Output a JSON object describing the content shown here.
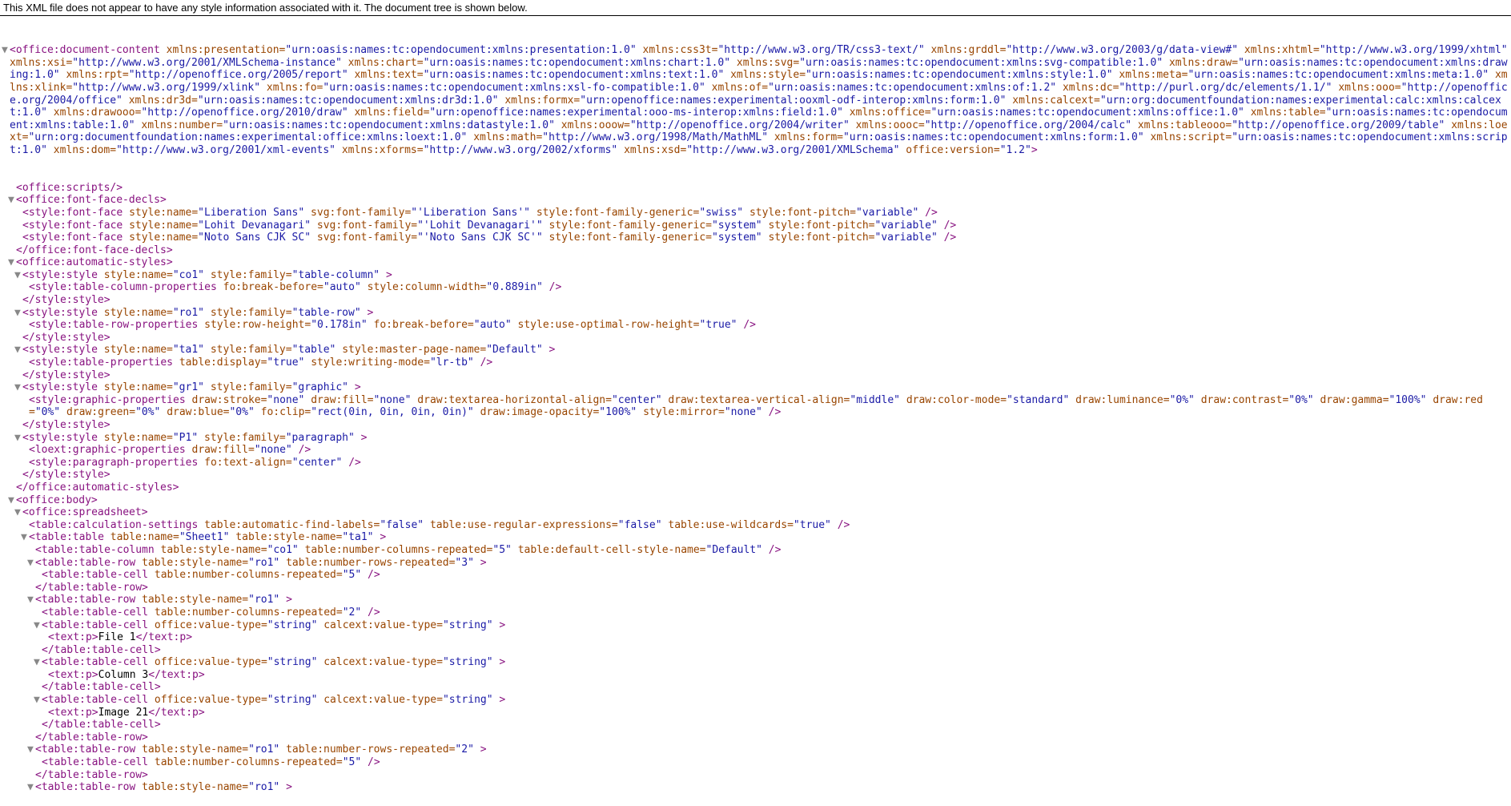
{
  "header_message": "This XML file does not appear to have any style information associated with it. The document tree is shown below.",
  "root": {
    "open": "<office:document-content",
    "attrs": [
      {
        "n": "xmlns:presentation",
        "v": "urn:oasis:names:tc:opendocument:xmlns:presentation:1.0"
      },
      {
        "n": "xmlns:css3t",
        "v": "http://www.w3.org/TR/css3-text/"
      },
      {
        "n": "xmlns:grddl",
        "v": "http://www.w3.org/2003/g/data-view#"
      },
      {
        "n": "xmlns:xhtml",
        "v": "http://www.w3.org/1999/xhtml"
      },
      {
        "n": "xmlns:xsi",
        "v": "http://www.w3.org/2001/XMLSchema-instance"
      },
      {
        "n": "xmlns:chart",
        "v": "urn:oasis:names:tc:opendocument:xmlns:chart:1.0"
      },
      {
        "n": "xmlns:svg",
        "v": "urn:oasis:names:tc:opendocument:xmlns:svg-compatible:1.0"
      },
      {
        "n": "xmlns:draw",
        "v": "urn:oasis:names:tc:opendocument:xmlns:drawing:1.0"
      },
      {
        "n": "xmlns:rpt",
        "v": "http://openoffice.org/2005/report"
      },
      {
        "n": "xmlns:text",
        "v": "urn:oasis:names:tc:opendocument:xmlns:text:1.0"
      },
      {
        "n": "xmlns:style",
        "v": "urn:oasis:names:tc:opendocument:xmlns:style:1.0"
      },
      {
        "n": "xmlns:meta",
        "v": "urn:oasis:names:tc:opendocument:xmlns:meta:1.0"
      },
      {
        "n": "xmlns:xlink",
        "v": "http://www.w3.org/1999/xlink"
      },
      {
        "n": "xmlns:fo",
        "v": "urn:oasis:names:tc:opendocument:xmlns:xsl-fo-compatible:1.0"
      },
      {
        "n": "xmlns:of",
        "v": "urn:oasis:names:tc:opendocument:xmlns:of:1.2"
      },
      {
        "n": "xmlns:dc",
        "v": "http://purl.org/dc/elements/1.1/"
      },
      {
        "n": "xmlns:ooo",
        "v": "http://openoffice.org/2004/office"
      },
      {
        "n": "xmlns:dr3d",
        "v": "urn:oasis:names:tc:opendocument:xmlns:dr3d:1.0"
      },
      {
        "n": "xmlns:formx",
        "v": "urn:openoffice:names:experimental:ooxml-odf-interop:xmlns:form:1.0"
      },
      {
        "n": "xmlns:calcext",
        "v": "urn:org:documentfoundation:names:experimental:calc:xmlns:calcext:1.0"
      },
      {
        "n": "xmlns:drawooo",
        "v": "http://openoffice.org/2010/draw"
      },
      {
        "n": "xmlns:field",
        "v": "urn:openoffice:names:experimental:ooo-ms-interop:xmlns:field:1.0"
      },
      {
        "n": "xmlns:office",
        "v": "urn:oasis:names:tc:opendocument:xmlns:office:1.0"
      },
      {
        "n": "xmlns:table",
        "v": "urn:oasis:names:tc:opendocument:xmlns:table:1.0"
      },
      {
        "n": "xmlns:number",
        "v": "urn:oasis:names:tc:opendocument:xmlns:datastyle:1.0"
      },
      {
        "n": "xmlns:ooow",
        "v": "http://openoffice.org/2004/writer"
      },
      {
        "n": "xmlns:oooc",
        "v": "http://openoffice.org/2004/calc"
      },
      {
        "n": "xmlns:tableooo",
        "v": "http://openoffice.org/2009/table"
      },
      {
        "n": "xmlns:loext",
        "v": "urn:org:documentfoundation:names:experimental:office:xmlns:loext:1.0"
      },
      {
        "n": "xmlns:math",
        "v": "http://www.w3.org/1998/Math/MathML"
      },
      {
        "n": "xmlns:form",
        "v": "urn:oasis:names:tc:opendocument:xmlns:form:1.0"
      },
      {
        "n": "xmlns:script",
        "v": "urn:oasis:names:tc:opendocument:xmlns:script:1.0"
      },
      {
        "n": "xmlns:dom",
        "v": "http://www.w3.org/2001/xml-events"
      },
      {
        "n": "xmlns:xforms",
        "v": "http://www.w3.org/2002/xforms"
      },
      {
        "n": "xmlns:xsd",
        "v": "http://www.w3.org/2001/XMLSchema"
      },
      {
        "n": "office:version",
        "v": "1.2"
      }
    ],
    "close": ">"
  },
  "lines": [
    {
      "i": 1,
      "t": null,
      "parts": [
        {
          "tag": "<office:scripts/>"
        }
      ]
    },
    {
      "i": 1,
      "t": "▼",
      "parts": [
        {
          "tag": "<office:font-face-decls>"
        }
      ]
    },
    {
      "i": 2,
      "t": null,
      "parts": [
        {
          "tag": "<style:font-face "
        },
        {
          "an": "style:name",
          "av": "Liberation Sans"
        },
        {
          "an": "svg:font-family",
          "av": "'Liberation Sans'"
        },
        {
          "an": "style:font-family-generic",
          "av": "swiss"
        },
        {
          "an": "style:font-pitch",
          "av": "variable"
        },
        {
          "tag": "/>"
        }
      ]
    },
    {
      "i": 2,
      "t": null,
      "parts": [
        {
          "tag": "<style:font-face "
        },
        {
          "an": "style:name",
          "av": "Lohit Devanagari"
        },
        {
          "an": "svg:font-family",
          "av": "'Lohit Devanagari'"
        },
        {
          "an": "style:font-family-generic",
          "av": "system"
        },
        {
          "an": "style:font-pitch",
          "av": "variable"
        },
        {
          "tag": "/>"
        }
      ]
    },
    {
      "i": 2,
      "t": null,
      "parts": [
        {
          "tag": "<style:font-face "
        },
        {
          "an": "style:name",
          "av": "Noto Sans CJK SC"
        },
        {
          "an": "svg:font-family",
          "av": "'Noto Sans CJK SC'"
        },
        {
          "an": "style:font-family-generic",
          "av": "system"
        },
        {
          "an": "style:font-pitch",
          "av": "variable"
        },
        {
          "tag": "/>"
        }
      ]
    },
    {
      "i": 1,
      "t": null,
      "parts": [
        {
          "tag": "</office:font-face-decls>"
        }
      ]
    },
    {
      "i": 1,
      "t": "▼",
      "parts": [
        {
          "tag": "<office:automatic-styles>"
        }
      ]
    },
    {
      "i": 2,
      "t": "▼",
      "parts": [
        {
          "tag": "<style:style "
        },
        {
          "an": "style:name",
          "av": "co1"
        },
        {
          "an": "style:family",
          "av": "table-column"
        },
        {
          "tag": ">"
        }
      ]
    },
    {
      "i": 3,
      "t": null,
      "parts": [
        {
          "tag": "<style:table-column-properties "
        },
        {
          "an": "fo:break-before",
          "av": "auto"
        },
        {
          "an": "style:column-width",
          "av": "0.889in"
        },
        {
          "tag": "/>"
        }
      ]
    },
    {
      "i": 2,
      "t": null,
      "parts": [
        {
          "tag": "</style:style>"
        }
      ]
    },
    {
      "i": 2,
      "t": "▼",
      "parts": [
        {
          "tag": "<style:style "
        },
        {
          "an": "style:name",
          "av": "ro1"
        },
        {
          "an": "style:family",
          "av": "table-row"
        },
        {
          "tag": ">"
        }
      ]
    },
    {
      "i": 3,
      "t": null,
      "parts": [
        {
          "tag": "<style:table-row-properties "
        },
        {
          "an": "style:row-height",
          "av": "0.178in"
        },
        {
          "an": "fo:break-before",
          "av": "auto"
        },
        {
          "an": "style:use-optimal-row-height",
          "av": "true"
        },
        {
          "tag": "/>"
        }
      ]
    },
    {
      "i": 2,
      "t": null,
      "parts": [
        {
          "tag": "</style:style>"
        }
      ]
    },
    {
      "i": 2,
      "t": "▼",
      "parts": [
        {
          "tag": "<style:style "
        },
        {
          "an": "style:name",
          "av": "ta1"
        },
        {
          "an": "style:family",
          "av": "table"
        },
        {
          "an": "style:master-page-name",
          "av": "Default"
        },
        {
          "tag": ">"
        }
      ]
    },
    {
      "i": 3,
      "t": null,
      "parts": [
        {
          "tag": "<style:table-properties "
        },
        {
          "an": "table:display",
          "av": "true"
        },
        {
          "an": "style:writing-mode",
          "av": "lr-tb"
        },
        {
          "tag": "/>"
        }
      ]
    },
    {
      "i": 2,
      "t": null,
      "parts": [
        {
          "tag": "</style:style>"
        }
      ]
    },
    {
      "i": 2,
      "t": "▼",
      "parts": [
        {
          "tag": "<style:style "
        },
        {
          "an": "style:name",
          "av": "gr1"
        },
        {
          "an": "style:family",
          "av": "graphic"
        },
        {
          "tag": ">"
        }
      ]
    },
    {
      "i": 3,
      "t": null,
      "parts": [
        {
          "tag": "<style:graphic-properties "
        },
        {
          "an": "draw:stroke",
          "av": "none"
        },
        {
          "an": "draw:fill",
          "av": "none"
        },
        {
          "an": "draw:textarea-horizontal-align",
          "av": "center"
        },
        {
          "an": "draw:textarea-vertical-align",
          "av": "middle"
        },
        {
          "an": "draw:color-mode",
          "av": "standard"
        },
        {
          "an": "draw:luminance",
          "av": "0%"
        },
        {
          "an": "draw:contrast",
          "av": "0%"
        },
        {
          "an": "draw:gamma",
          "av": "100%"
        },
        {
          "an": "draw:red",
          "av": "0%"
        },
        {
          "an": "draw:green",
          "av": "0%"
        },
        {
          "an": "draw:blue",
          "av": "0%"
        },
        {
          "an": "fo:clip",
          "av": "rect(0in, 0in, 0in, 0in)"
        },
        {
          "an": "draw:image-opacity",
          "av": "100%"
        },
        {
          "an": "style:mirror",
          "av": "none"
        },
        {
          "tag": "/>"
        }
      ]
    },
    {
      "i": 2,
      "t": null,
      "parts": [
        {
          "tag": "</style:style>"
        }
      ]
    },
    {
      "i": 2,
      "t": "▼",
      "parts": [
        {
          "tag": "<style:style "
        },
        {
          "an": "style:name",
          "av": "P1"
        },
        {
          "an": "style:family",
          "av": "paragraph"
        },
        {
          "tag": ">"
        }
      ]
    },
    {
      "i": 3,
      "t": null,
      "parts": [
        {
          "tag": "<loext:graphic-properties "
        },
        {
          "an": "draw:fill",
          "av": "none"
        },
        {
          "tag": "/>"
        }
      ]
    },
    {
      "i": 3,
      "t": null,
      "parts": [
        {
          "tag": "<style:paragraph-properties "
        },
        {
          "an": "fo:text-align",
          "av": "center"
        },
        {
          "tag": "/>"
        }
      ]
    },
    {
      "i": 2,
      "t": null,
      "parts": [
        {
          "tag": "</style:style>"
        }
      ]
    },
    {
      "i": 1,
      "t": null,
      "parts": [
        {
          "tag": "</office:automatic-styles>"
        }
      ]
    },
    {
      "i": 1,
      "t": "▼",
      "parts": [
        {
          "tag": "<office:body>"
        }
      ]
    },
    {
      "i": 2,
      "t": "▼",
      "parts": [
        {
          "tag": "<office:spreadsheet>"
        }
      ]
    },
    {
      "i": 3,
      "t": null,
      "parts": [
        {
          "tag": "<table:calculation-settings "
        },
        {
          "an": "table:automatic-find-labels",
          "av": "false"
        },
        {
          "an": "table:use-regular-expressions",
          "av": "false"
        },
        {
          "an": "table:use-wildcards",
          "av": "true"
        },
        {
          "tag": "/>"
        }
      ]
    },
    {
      "i": 3,
      "t": "▼",
      "parts": [
        {
          "tag": "<table:table "
        },
        {
          "an": "table:name",
          "av": "Sheet1"
        },
        {
          "an": "table:style-name",
          "av": "ta1"
        },
        {
          "tag": ">"
        }
      ]
    },
    {
      "i": 4,
      "t": null,
      "parts": [
        {
          "tag": "<table:table-column "
        },
        {
          "an": "table:style-name",
          "av": "co1"
        },
        {
          "an": "table:number-columns-repeated",
          "av": "5"
        },
        {
          "an": "table:default-cell-style-name",
          "av": "Default"
        },
        {
          "tag": "/>"
        }
      ]
    },
    {
      "i": 4,
      "t": "▼",
      "parts": [
        {
          "tag": "<table:table-row "
        },
        {
          "an": "table:style-name",
          "av": "ro1"
        },
        {
          "an": "table:number-rows-repeated",
          "av": "3"
        },
        {
          "tag": ">"
        }
      ]
    },
    {
      "i": 5,
      "t": null,
      "parts": [
        {
          "tag": "<table:table-cell "
        },
        {
          "an": "table:number-columns-repeated",
          "av": "5"
        },
        {
          "tag": "/>"
        }
      ]
    },
    {
      "i": 4,
      "t": null,
      "parts": [
        {
          "tag": "</table:table-row>"
        }
      ]
    },
    {
      "i": 4,
      "t": "▼",
      "parts": [
        {
          "tag": "<table:table-row "
        },
        {
          "an": "table:style-name",
          "av": "ro1"
        },
        {
          "tag": ">"
        }
      ]
    },
    {
      "i": 5,
      "t": null,
      "parts": [
        {
          "tag": "<table:table-cell "
        },
        {
          "an": "table:number-columns-repeated",
          "av": "2"
        },
        {
          "tag": "/>"
        }
      ]
    },
    {
      "i": 5,
      "t": "▼",
      "parts": [
        {
          "tag": "<table:table-cell "
        },
        {
          "an": "office:value-type",
          "av": "string"
        },
        {
          "an": "calcext:value-type",
          "av": "string"
        },
        {
          "tag": ">"
        }
      ]
    },
    {
      "i": 6,
      "t": null,
      "parts": [
        {
          "tag": "<text:p>"
        },
        {
          "txt": "File 1"
        },
        {
          "tag": "</text:p>"
        }
      ]
    },
    {
      "i": 5,
      "t": null,
      "parts": [
        {
          "tag": "</table:table-cell>"
        }
      ]
    },
    {
      "i": 5,
      "t": "▼",
      "parts": [
        {
          "tag": "<table:table-cell "
        },
        {
          "an": "office:value-type",
          "av": "string"
        },
        {
          "an": "calcext:value-type",
          "av": "string"
        },
        {
          "tag": ">"
        }
      ]
    },
    {
      "i": 6,
      "t": null,
      "parts": [
        {
          "tag": "<text:p>"
        },
        {
          "txt": "Column 3"
        },
        {
          "tag": "</text:p>"
        }
      ]
    },
    {
      "i": 5,
      "t": null,
      "parts": [
        {
          "tag": "</table:table-cell>"
        }
      ]
    },
    {
      "i": 5,
      "t": "▼",
      "parts": [
        {
          "tag": "<table:table-cell "
        },
        {
          "an": "office:value-type",
          "av": "string"
        },
        {
          "an": "calcext:value-type",
          "av": "string"
        },
        {
          "tag": ">"
        }
      ]
    },
    {
      "i": 6,
      "t": null,
      "parts": [
        {
          "tag": "<text:p>"
        },
        {
          "txt": "Image 21"
        },
        {
          "tag": "</text:p>"
        }
      ]
    },
    {
      "i": 5,
      "t": null,
      "parts": [
        {
          "tag": "</table:table-cell>"
        }
      ]
    },
    {
      "i": 4,
      "t": null,
      "parts": [
        {
          "tag": "</table:table-row>"
        }
      ]
    },
    {
      "i": 4,
      "t": "▼",
      "parts": [
        {
          "tag": "<table:table-row "
        },
        {
          "an": "table:style-name",
          "av": "ro1"
        },
        {
          "an": "table:number-rows-repeated",
          "av": "2"
        },
        {
          "tag": ">"
        }
      ]
    },
    {
      "i": 5,
      "t": null,
      "parts": [
        {
          "tag": "<table:table-cell "
        },
        {
          "an": "table:number-columns-repeated",
          "av": "5"
        },
        {
          "tag": "/>"
        }
      ]
    },
    {
      "i": 4,
      "t": null,
      "parts": [
        {
          "tag": "</table:table-row>"
        }
      ]
    },
    {
      "i": 4,
      "t": "▼",
      "parts": [
        {
          "tag": "<table:table-row "
        },
        {
          "an": "table:style-name",
          "av": "ro1"
        },
        {
          "tag": ">"
        }
      ]
    }
  ]
}
